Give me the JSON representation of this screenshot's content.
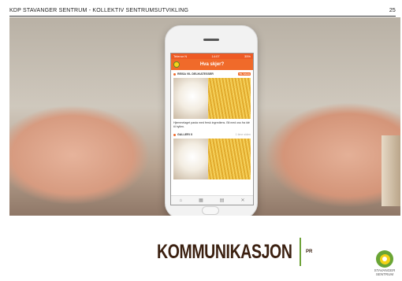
{
  "header": {
    "text": "KDP STAVANGER SENTRUM - KOLLEKTIV SENTRUMSUTVIKLING",
    "page_number": "25"
  },
  "phone_screen": {
    "status_left": "Telenor N",
    "status_center": "14:07",
    "status_right": "35%",
    "app_title": "Hva skjer?",
    "section1_label": "REISA VIL DELIKATESSER",
    "section1_tag": "TIL SALG",
    "body_text": "Hjemmelaget pasta med fersk ingrediens. Bli med oss fra idé til hyllen.",
    "section2_label": "GALLERI X",
    "section2_time": "1 time siden",
    "tab_icons": [
      "home-icon",
      "grid-icon",
      "bag-icon",
      "tools-icon"
    ]
  },
  "title": {
    "main": "KOMMUNIKASJON",
    "sub": "PR"
  },
  "logo": {
    "line1": "STAVANGER",
    "line2": "SENTRUM"
  },
  "colors": {
    "accent": "#f06a2a",
    "green": "#6fa33a",
    "title": "#3b2010"
  }
}
